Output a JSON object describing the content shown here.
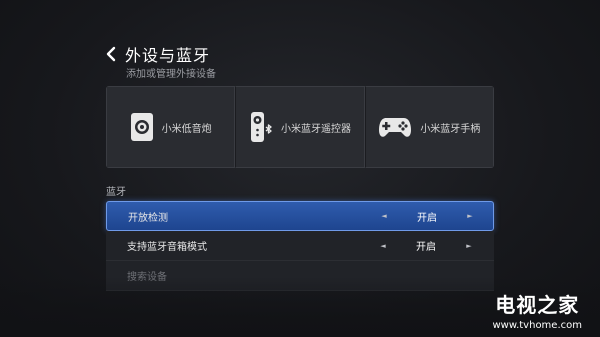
{
  "header": {
    "back_icon": "chevron-left-icon",
    "title": "外设与蓝牙",
    "subtitle": "添加或管理外接设备"
  },
  "devices": [
    {
      "label": "小米低音炮",
      "icon": "subwoofer-icon"
    },
    {
      "label": "小米蓝牙遥控器",
      "icon": "bluetooth-remote-icon"
    },
    {
      "label": "小米蓝牙手柄",
      "icon": "gamepad-icon"
    }
  ],
  "bluetooth": {
    "section_label": "蓝牙",
    "rows": [
      {
        "label": "开放检测",
        "value": "开启",
        "selected": true
      },
      {
        "label": "支持蓝牙音箱模式",
        "value": "开启",
        "selected": false
      },
      {
        "label": "搜索设备",
        "value": "",
        "selected": false
      }
    ]
  },
  "watermark": {
    "name": "电视之家",
    "url": "www.tvhome.com"
  },
  "colors": {
    "accent": "#2f5cae",
    "accent_border": "#6f9ae8",
    "background": "#17181c"
  }
}
